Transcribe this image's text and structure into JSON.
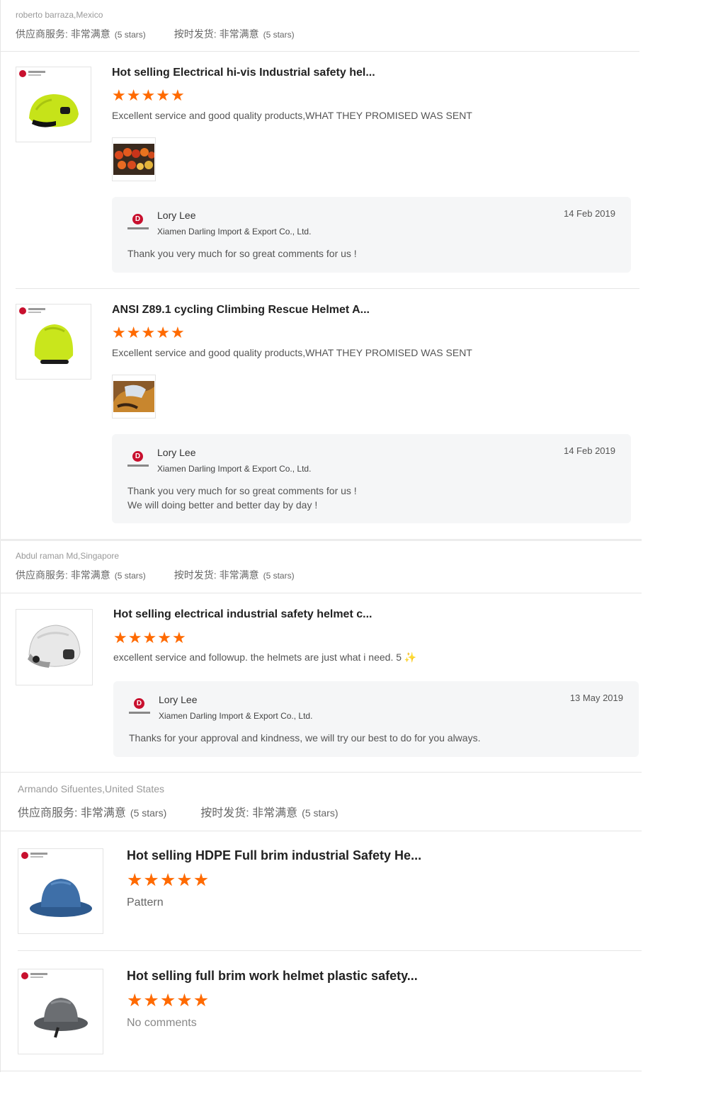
{
  "accent_color": "#ff6a00",
  "groups": [
    {
      "reviewer": "roberto barraza,Mexico",
      "supplier_label": "供应商服务: 非常满意",
      "supplier_stars": "(5 stars)",
      "ship_label": "按时发货: 非常满意",
      "ship_stars": "(5 stars)",
      "items": [
        {
          "title": "Hot selling Electrical hi-vis Industrial safety hel...",
          "rating": 5,
          "comment": "Excellent service and good quality products,WHAT THEY PROMISED WAS SENT",
          "helmet_color": "#c6e319",
          "reply": {
            "name": "Lory Lee",
            "company": "Xiamen Darling Import & Export Co., Ltd.",
            "date": "14 Feb 2019",
            "text_1": "Thank you very much for so great comments for us !",
            "text_2": ""
          }
        },
        {
          "title": "ANSI Z89.1 cycling Climbing Rescue Helmet A...",
          "rating": 5,
          "comment": "Excellent service and good quality products,WHAT THEY PROMISED WAS SENT",
          "helmet_color": "#c9e61c",
          "reply": {
            "name": "Lory Lee",
            "company": "Xiamen Darling Import & Export Co., Ltd.",
            "date": "14 Feb 2019",
            "text_1": "Thank you very much for so great comments for us !",
            "text_2": "We will doing better and better day by day !"
          }
        }
      ]
    },
    {
      "reviewer": "Abdul raman Md,Singapore",
      "supplier_label": "供应商服务: 非常满意",
      "supplier_stars": "(5 stars)",
      "ship_label": "按时发货: 非常满意",
      "ship_stars": "(5 stars)",
      "items": [
        {
          "title": "Hot selling electrical industrial safety helmet c...",
          "rating": 5,
          "comment": "excellent service and followup. the helmets are just what i need. 5",
          "helmet_color": "#e8e8e8",
          "reply": {
            "name": "Lory Lee",
            "company": "Xiamen Darling Import & Export Co., Ltd.",
            "date": "13 May 2019",
            "text_1": "Thanks for your approval and kindness, we will try our best to do for you always.",
            "text_2": ""
          }
        }
      ]
    },
    {
      "reviewer": "Armando Sifuentes,United States",
      "supplier_label": "供应商服务: 非常满意",
      "supplier_stars": "(5 stars)",
      "ship_label": "按时发货: 非常满意",
      "ship_stars": "(5 stars)",
      "items": [
        {
          "title": "Hot selling HDPE Full brim industrial Safety He...",
          "rating": 5,
          "comment": "Pattern",
          "helmet_color": "#3e6fa8"
        },
        {
          "title": "Hot selling full brim work helmet plastic safety...",
          "rating": 5,
          "comment": "No comments",
          "helmet_color": "#6b6e72"
        }
      ]
    }
  ]
}
